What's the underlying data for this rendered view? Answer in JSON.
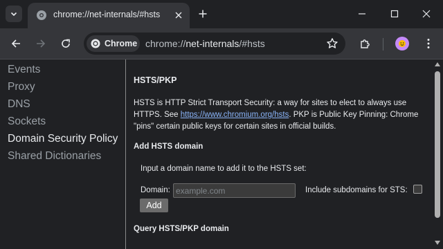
{
  "tab": {
    "title": "chrome://net-internals/#hsts"
  },
  "toolbar": {
    "chip_label": "Chrome",
    "url_scheme": "chrome://",
    "url_host": "net-internals",
    "url_path": "/#hsts"
  },
  "sidebar": {
    "items": [
      {
        "label": "Events",
        "active": false
      },
      {
        "label": "Proxy",
        "active": false
      },
      {
        "label": "DNS",
        "active": false
      },
      {
        "label": "Sockets",
        "active": false
      },
      {
        "label": "Domain Security Policy",
        "active": true
      },
      {
        "label": "Shared Dictionaries",
        "active": false
      }
    ]
  },
  "main": {
    "heading": "HSTS/PKP",
    "intro_a": "HSTS is HTTP Strict Transport Security: a way for sites to elect to always use HTTPS. See ",
    "intro_link": "https://www.chromium.org/hsts",
    "intro_b": ". PKP is Public Key Pinning: Chrome \"pins\" certain public keys for certain sites in official builds.",
    "add_heading": "Add HSTS domain",
    "add_instruction": "Input a domain name to add it to the HSTS set:",
    "domain_label": "Domain:",
    "domain_placeholder": "example.com",
    "domain_value": "",
    "subdomains_label": "Include subdomains for STS:",
    "add_button": "Add",
    "query_heading": "Query HSTS/PKP domain"
  },
  "icons": {
    "tab_search": "chevron-down-icon",
    "favicon": "globe-icon",
    "close": "close-icon",
    "new_tab": "plus-icon",
    "minimize": "minimize-icon",
    "maximize": "maximize-icon",
    "window_close": "window-close-icon",
    "back": "arrow-left-icon",
    "forward": "arrow-right-icon",
    "reload": "reload-icon",
    "bookmark": "star-icon",
    "extensions": "puzzle-icon",
    "profile": "avatar-icon",
    "menu": "kebab-icon"
  },
  "colors": {
    "link": "#8ab4f8",
    "background": "#202124",
    "toolbar": "#35363a"
  }
}
